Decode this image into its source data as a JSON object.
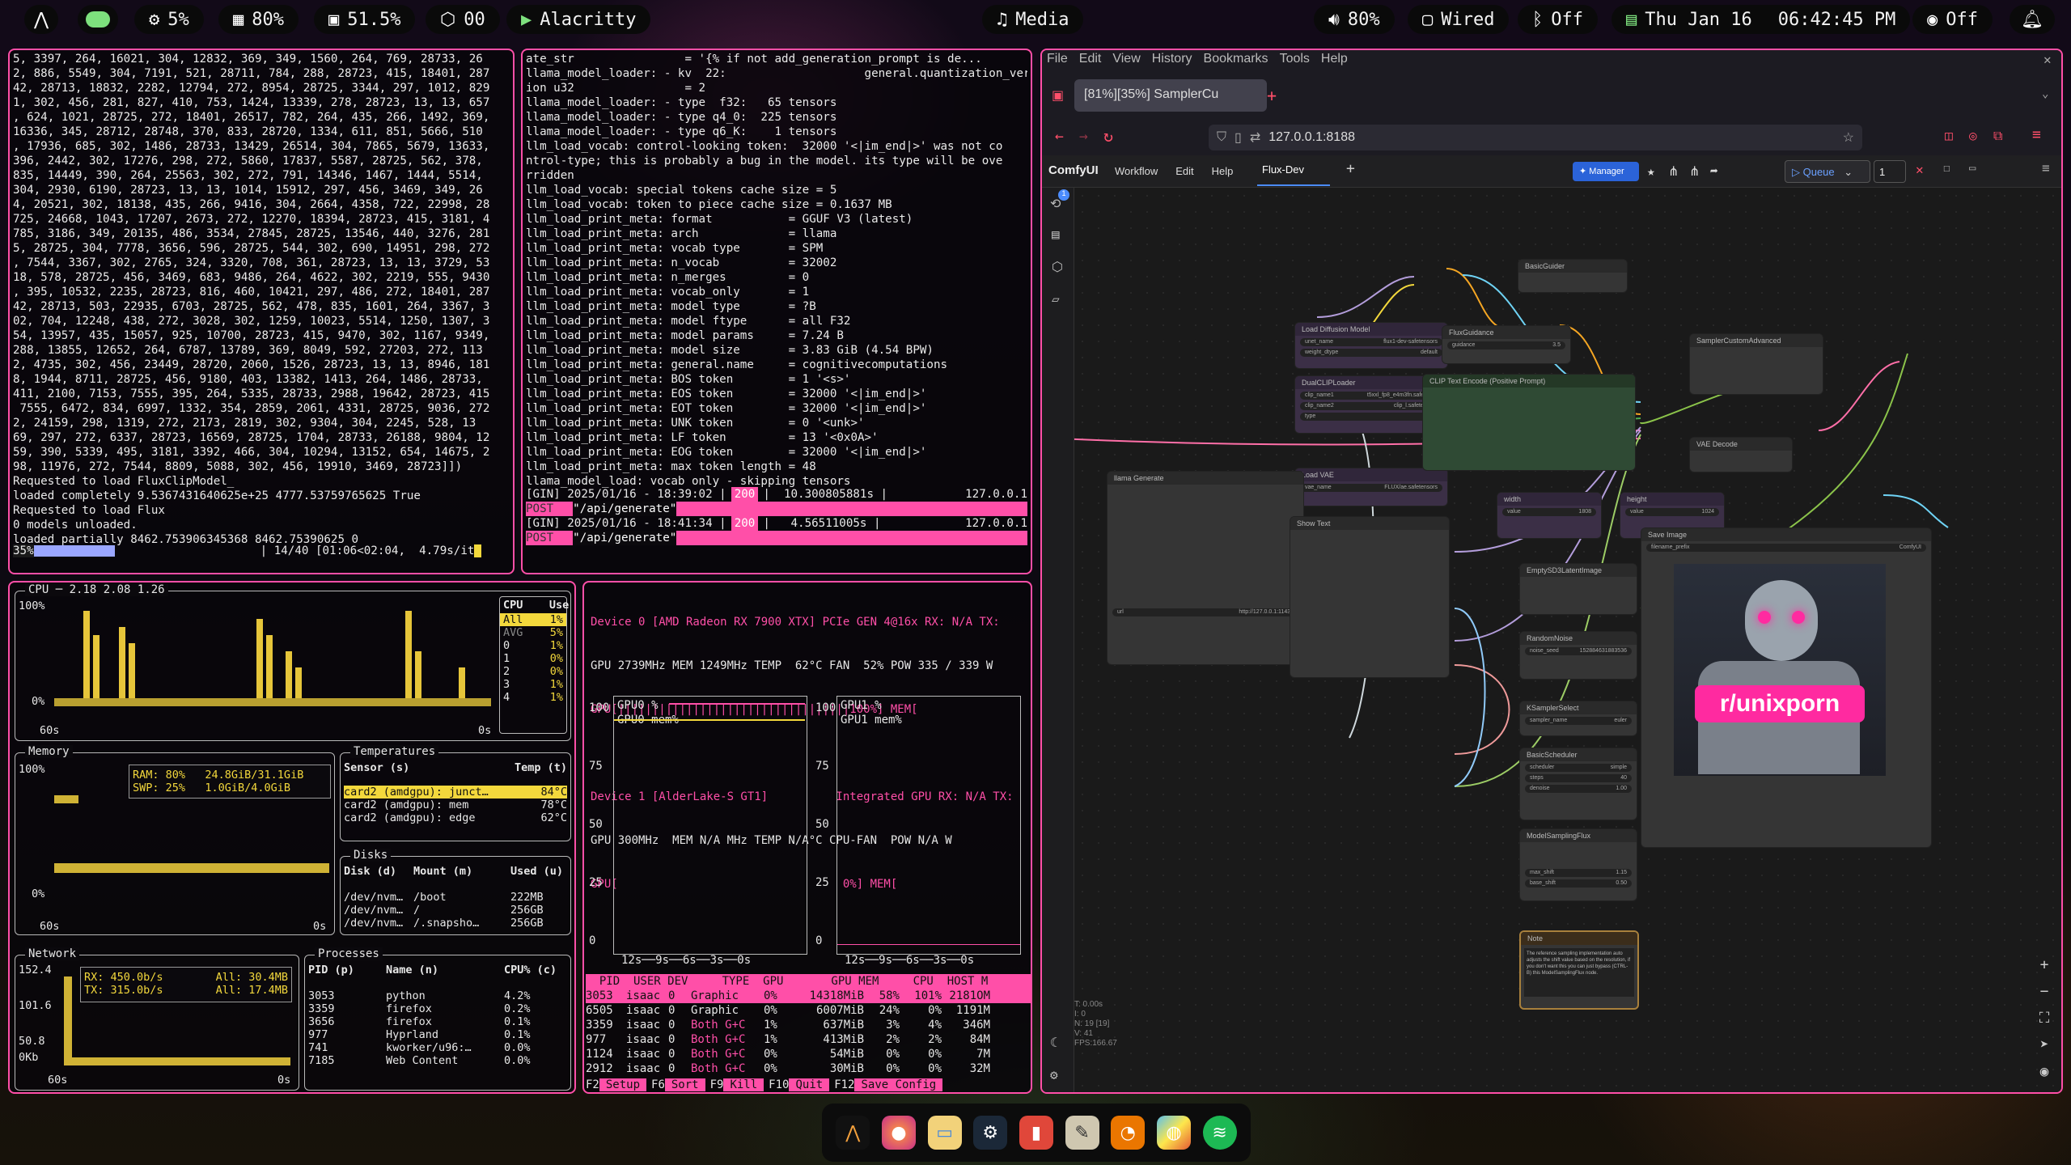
{
  "topbar": {
    "cpu": "5%",
    "mem": "80%",
    "disk": "51.5%",
    "gpu_count": "00",
    "window": "Alacritty",
    "media": "Media",
    "volume": "80%",
    "network": "Wired",
    "bluetooth": "Off",
    "date": "Thu Jan 16",
    "time": "06:42:45 PM",
    "power_mode": "Off"
  },
  "term1": {
    "lines": [
      "5, 3397, 264, 16021, 304, 12832, 369, 349, 1560, 264, 769, 28733, 26",
      "2, 886, 5549, 304, 7191, 521, 28711, 784, 288, 28723, 415, 18401, 287",
      "42, 28713, 18832, 2282, 12794, 272, 8954, 28725, 3344, 297, 1012, 829",
      "1, 302, 456, 281, 827, 410, 753, 1424, 13339, 278, 28723, 13, 13, 657",
      ", 624, 1021, 28725, 272, 18401, 26517, 782, 264, 435, 266, 1492, 369,",
      "16336, 345, 28712, 28748, 370, 833, 28720, 1334, 611, 851, 5666, 510",
      ", 17936, 685, 302, 1486, 28733, 13429, 26514, 304, 7865, 5679, 13633,",
      "396, 2442, 302, 17276, 298, 272, 5860, 17837, 5587, 28725, 562, 378,",
      "835, 14449, 390, 264, 25563, 302, 272, 791, 14346, 1467, 1444, 5514,",
      "304, 2930, 6190, 28723, 13, 13, 1014, 15912, 297, 456, 3469, 349, 26",
      "4, 20521, 302, 18138, 435, 266, 9416, 304, 2664, 4358, 722, 22998, 28",
      "725, 24668, 1043, 17207, 2673, 272, 12270, 18394, 28723, 415, 3181, 4",
      "785, 3186, 349, 20135, 486, 3534, 27845, 28725, 13546, 440, 3276, 281",
      "5, 28725, 304, 7778, 3656, 596, 28725, 544, 302, 690, 14951, 298, 272",
      ", 7544, 3367, 302, 2765, 324, 3320, 708, 361, 28723, 13, 13, 3729, 53",
      "18, 578, 28725, 456, 3469, 683, 9486, 264, 4622, 302, 2219, 555, 9430",
      ", 395, 10532, 2235, 28723, 816, 460, 10421, 297, 486, 272, 18401, 287",
      "42, 28713, 503, 22935, 6703, 28725, 562, 478, 835, 1601, 264, 3367, 3",
      "02, 704, 12248, 438, 272, 3028, 302, 1259, 10023, 5514, 1250, 1307, 3",
      "54, 13957, 435, 15057, 925, 10700, 28723, 415, 9470, 302, 1167, 9349,",
      "288, 13855, 12652, 264, 6787, 13789, 369, 8049, 592, 27203, 272, 113",
      "2, 4735, 302, 456, 23449, 28720, 2060, 1526, 28723, 13, 13, 8946, 181",
      "8, 1944, 8711, 28725, 456, 9180, 403, 13382, 1413, 264, 1486, 28733,",
      "411, 2100, 7153, 7555, 395, 264, 5335, 28733, 2988, 19642, 28723, 415",
      " 7555, 6472, 834, 6997, 1332, 354, 2859, 2061, 4331, 28725, 9036, 272",
      "2, 24159, 298, 1319, 272, 2173, 2819, 302, 9304, 304, 2245, 528, 13",
      "69, 297, 272, 6337, 28723, 16569, 28725, 1704, 28733, 26188, 9804, 12",
      "59, 390, 5339, 495, 3181, 3392, 466, 304, 10294, 13152, 654, 14675, 2",
      "98, 11976, 272, 7544, 8809, 5088, 302, 456, 19910, 3469, 28723]])",
      "Requested to load FluxClipModel_",
      "loaded completely 9.5367431640625e+25 4777.53759765625 True",
      "Requested to load Flux",
      "0 models unloaded.",
      "loaded partially 8462.753906345368 8462.75390625 0"
    ],
    "progress_pct": "35%",
    "progress_tail": "| 14/40 [01:06<02:04,  4.79s/it"
  },
  "term2": {
    "lines": [
      "ate_str                = '{% if not add_generation_prompt is de...",
      "llama_model_loader: - kv  22:                    general.quantization_vers",
      "ion u32                = 2",
      "llama_model_loader: - type  f32:   65 tensors",
      "llama_model_loader: - type q4_0:  225 tensors",
      "llama_model_loader: - type q6_K:    1 tensors",
      "llm_load_vocab: control-looking token:  32000 '<|im_end|>' was not co",
      "ntrol-type; this is probably a bug in the model. its type will be ove",
      "rridden",
      "llm_load_vocab: special tokens cache size = 5",
      "llm_load_vocab: token to piece cache size = 0.1637 MB",
      "llm_load_print_meta: format           = GGUF V3 (latest)",
      "llm_load_print_meta: arch             = llama",
      "llm_load_print_meta: vocab type       = SPM",
      "llm_load_print_meta: n_vocab          = 32002",
      "llm_load_print_meta: n_merges         = 0",
      "llm_load_print_meta: vocab_only       = 1",
      "llm_load_print_meta: model type       = ?B",
      "llm_load_print_meta: model ftype      = all F32",
      "llm_load_print_meta: model params     = 7.24 B",
      "llm_load_print_meta: model size       = 3.83 GiB (4.54 BPW)",
      "llm_load_print_meta: general.name     = cognitivecomputations",
      "llm_load_print_meta: BOS token        = 1 '<s>'",
      "llm_load_print_meta: EOS token        = 32000 '<|im_end|>'",
      "llm_load_print_meta: EOT token        = 32000 '<|im_end|>'",
      "llm_load_print_meta: UNK token        = 0 '<unk>'",
      "llm_load_print_meta: LF token         = 13 '<0x0A>'",
      "llm_load_print_meta: EOG token        = 32000 '<|im_end|>'",
      "llm_load_print_meta: max token length = 48",
      "llama_model_load: vocab only - skipping tensors"
    ],
    "gin": [
      {
        "a": "[GIN] 2025/01/16 - 18:39:02 |",
        "code": "200",
        "b": "|  10.300805881s |",
        "ip": "127.0.0.1",
        "method": "POST",
        "path": "\"/api/generate\""
      },
      {
        "a": "[GIN] 2025/01/16 - 18:41:34 |",
        "code": "200",
        "b": "|   4.56511005s |",
        "ip": "127.0.0.1",
        "method": "POST",
        "path": "\"/api/generate\""
      }
    ]
  },
  "btop": {
    "cpu_title": "CPU",
    "cpu_load": "2.18 2.08 1.26",
    "cpu_col": "CPU",
    "use_col": "Use",
    "cpu_rows": [
      [
        "All",
        "1%"
      ],
      [
        "AVG",
        "5%"
      ],
      [
        "0",
        "1%"
      ],
      [
        "1",
        "0%"
      ],
      [
        "2",
        "0%"
      ],
      [
        "3",
        "1%"
      ],
      [
        "4",
        "1%"
      ]
    ],
    "cpu_y_top": "100%",
    "cpu_y_bot": "0%",
    "cpu_x_left": "60s",
    "cpu_x_right": "0s",
    "mem_title": "Memory",
    "mem_y_top": "100%",
    "mem_y_bot": "0%",
    "mem_x_left": "60s",
    "mem_x_right": "0s",
    "ram": "RAM: 80%   24.8GiB/31.1GiB",
    "swp": "SWP: 25%   1.0GiB/4.0GiB",
    "temps_title": "Temperatures",
    "sensor_col": "Sensor (s)",
    "temp_col": "Temp (t)",
    "temps": [
      [
        "card2 (amdgpu): junct…",
        "84°C"
      ],
      [
        "card2 (amdgpu): mem",
        "78°C"
      ],
      [
        "card2 (amdgpu): edge",
        "62°C"
      ]
    ],
    "disks_title": "Disks",
    "disk_cols": [
      "Disk (d)",
      "Mount (m)",
      "Used (u)"
    ],
    "disks": [
      [
        "/dev/nvm…",
        "/boot",
        "222MB"
      ],
      [
        "/dev/nvm…",
        "/",
        "256GB"
      ],
      [
        "/dev/nvm…",
        "/.snapsho…",
        "256GB"
      ]
    ],
    "net_title": "Network",
    "net_y": [
      "152.4",
      "101.6",
      "50.8",
      "0Kb"
    ],
    "rx": "RX: 450.0b/s",
    "rx_all": "All: 30.4MB",
    "tx": "TX: 315.0b/s",
    "tx_all": "All: 17.4MB",
    "net_x_left": "60s",
    "net_x_right": "0s",
    "proc_title": "Processes",
    "proc_cols": [
      "PID (p)",
      "Name (n)",
      "CPU% (c)"
    ],
    "procs": [
      [
        "3053",
        "python",
        "4.2%"
      ],
      [
        "3359",
        "firefox",
        "0.2%"
      ],
      [
        "3656",
        "firefox",
        "0.1%"
      ],
      [
        "977",
        "Hyprland",
        "0.1%"
      ],
      [
        "741",
        "kworker/u96:…",
        "0.0%"
      ],
      [
        "7185",
        "Web Content",
        "0.0%"
      ]
    ]
  },
  "nvtop": {
    "dev0": "Device 0 [AMD Radeon RX 7900 XTX] PCIe GEN 4@16x RX: N/A TX:",
    "dev0_stats": "GPU 2739MHz MEM 1249MHz TEMP  62°C FAN  52% POW 335 / 339 W",
    "dev0_bar": "GPU[||||||||||||||||||||||||||||||||||100%] MEM[",
    "dev1": "Device 1 [AlderLake-S GT1]          Integrated GPU RX: N/A TX:",
    "dev1_stats": "GPU 300MHz  MEM N/A MHz TEMP N/A°C CPU-FAN  POW N/A W",
    "dev1_bar": "GPU[                                 0%] MEM[",
    "g0_legend1": "GPU0 %",
    "g0_legend2": "GPU0 mem%",
    "g1_legend1": "GPU1 %",
    "g1_legend2": "GPU1 mem%",
    "y_ticks": [
      "100",
      "75",
      "50",
      "25",
      "0"
    ],
    "x_axis": "12s──9s──6s──3s──0s",
    "cols": "  PID  USER DEV     TYPE  GPU       GPU MEM     CPU  HOST M",
    "procs": [
      [
        "3053",
        "isaac",
        "0",
        "Graphic",
        "0%",
        "14318MiB",
        "58%",
        "101%",
        "2181OM"
      ],
      [
        "6505",
        "isaac",
        "0",
        "Graphic",
        "0%",
        "6007MiB",
        "24%",
        "0%",
        "1191M"
      ],
      [
        "3359",
        "isaac",
        "0",
        "Both G+C",
        "1%",
        "637MiB",
        "3%",
        "4%",
        "346M"
      ],
      [
        "977",
        "isaac",
        "0",
        "Both G+C",
        "1%",
        "413MiB",
        "2%",
        "2%",
        "84M"
      ],
      [
        "1124",
        "isaac",
        "0",
        "Both G+C",
        "0%",
        "54MiB",
        "0%",
        "0%",
        "7M"
      ],
      [
        "2912",
        "isaac",
        "0",
        "Both G+C",
        "0%",
        "30MiB",
        "0%",
        "0%",
        "32M"
      ]
    ],
    "footer": [
      [
        "F2",
        "Setup"
      ],
      [
        "F6",
        "Sort"
      ],
      [
        "F9",
        "Kill"
      ],
      [
        "F10",
        "Quit"
      ],
      [
        "F12",
        "Save Config"
      ]
    ]
  },
  "browser": {
    "menu": [
      "File",
      "Edit",
      "View",
      "History",
      "Bookmarks",
      "Tools",
      "Help"
    ],
    "tab_title": "[81%][35%] SamplerCu",
    "url": "127.0.0.1:8188",
    "comfy": {
      "brand": "ComfyUI",
      "menu": [
        "Workflow",
        "Edit",
        "Help"
      ],
      "workflow_tab": "Flux-Dev",
      "manager": "Manager",
      "queue": "Queue",
      "batch": "1",
      "badge": "1"
    },
    "nodes": {
      "load_diffusion": "Load Diffusion Model",
      "unet": "flux1-dev-safetensors",
      "weight": "default",
      "dualclip": "DualCLIPLoader",
      "clip1": "t5xxl_fp8_e4m3fn.safeten…",
      "clip2": "clip_l.safetensors",
      "clip_type": "flux",
      "loadvae": "Load VAE",
      "vae": "FLUX/ae.safetensors",
      "guider": "BasicGuider",
      "flux_guidance": "FluxGuidance",
      "guidance": "3.5",
      "clip_encode": "CLIP Text Encode (Positive Prompt)",
      "sampler_custom": "SamplerCustomAdvanced",
      "vae_decode": "VAE Decode",
      "width": "width",
      "height": "height",
      "width_val": "1808",
      "height_val": "1024",
      "empty_latent": "EmptySD3LatentImage",
      "noise": "RandomNoise",
      "seed": "152884631883536",
      "ksampler_select": "KSamplerSelect",
      "sampler_name": "euler",
      "scheduler": "BasicScheduler",
      "sched": "simple",
      "steps": "40",
      "denoise": "1.00",
      "model_sampling": "ModelSamplingFlux",
      "max_shift": "1.15",
      "base_shift": "0.50",
      "show_text": "Show Text",
      "llama_gen": "llama Generate",
      "ollama_url": "http://127.0.0.1:11434",
      "save_image": "Save Image",
      "filename_prefix": "ComfyUI",
      "note": "Note",
      "poster_text": "r/unixporn",
      "note_text": "The reference sampling implementation auto adjusts the shift value based on the resolution, if you don't want this you can just bypass (CTRL-B) this ModelSamplingFlux node."
    },
    "stats": [
      "T: 0.00s",
      "I: 0",
      "N: 19 [19]",
      "V: 41",
      "FPS:166.67"
    ]
  },
  "dock": [
    "alacritty",
    "firefox",
    "files",
    "steam",
    "audio",
    "gimp",
    "blender",
    "color",
    "spotify"
  ]
}
